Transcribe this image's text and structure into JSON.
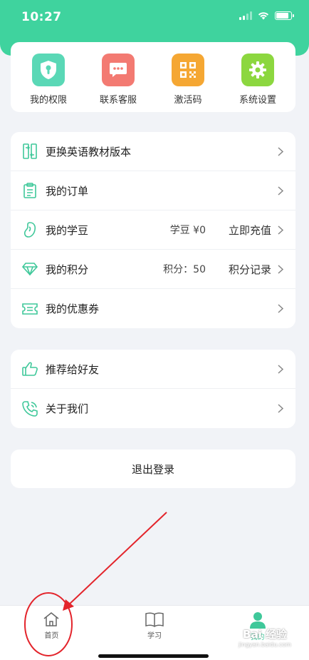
{
  "status_bar": {
    "time": "10:27"
  },
  "colors": {
    "accent": "#3fd39e",
    "privilege": "#5ad8b6",
    "service": "#f37a72",
    "activate": "#f5a733",
    "settings": "#8cd73f",
    "annotation": "#e3242b"
  },
  "quick_actions": [
    {
      "label": "我的权限",
      "icon": "shield-icon"
    },
    {
      "label": "联系客服",
      "icon": "chat-icon"
    },
    {
      "label": "激活码",
      "icon": "qrcode-icon"
    },
    {
      "label": "系统设置",
      "icon": "gear-icon"
    }
  ],
  "menu": {
    "textbook": {
      "label": "更换英语教材版本"
    },
    "orders": {
      "label": "我的订单"
    },
    "beans": {
      "label": "我的学豆",
      "value": "学豆 ¥0",
      "action": "立即充值"
    },
    "points": {
      "label": "我的积分",
      "value": "积分：50",
      "action": "积分记录"
    },
    "coupons": {
      "label": "我的优惠券"
    }
  },
  "menu2": {
    "recommend": {
      "label": "推荐给好友"
    },
    "about": {
      "label": "关于我们"
    }
  },
  "logout": {
    "label": "退出登录"
  },
  "tabs": {
    "home": {
      "label": "首页",
      "icon": "home-icon"
    },
    "study": {
      "label": "学习",
      "icon": "book-icon"
    },
    "me": {
      "label": "我的",
      "icon": "user-icon"
    }
  },
  "watermark": {
    "main": "Bai 经验",
    "sub": "jingyan.baidu.com"
  }
}
